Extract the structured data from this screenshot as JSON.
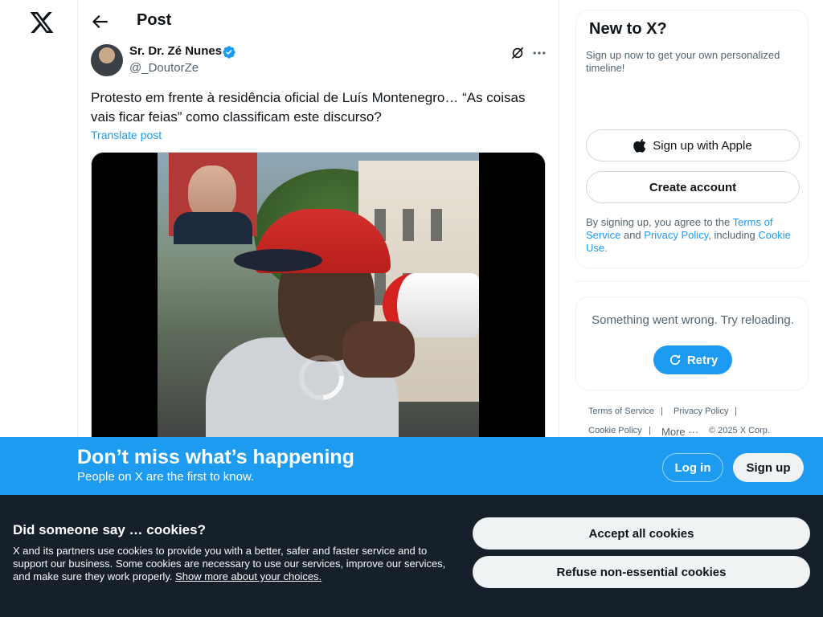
{
  "header": {
    "title": "Post"
  },
  "post": {
    "author_name": "Sr. Dr. Zé Nunes",
    "author_handle": "@_DoutorZe",
    "text": "Protesto em frente à residência oficial de Luís Montenegro… “As coisas vais ficar feias” como classificam este discurso?",
    "translate_label": "Translate post"
  },
  "signup_card": {
    "title": "New to X?",
    "subtitle": "Sign up now to get your own personalized timeline!",
    "apple_label": "Sign up with Apple",
    "create_label": "Create account",
    "terms_prefix": "By signing up, you agree to the ",
    "terms_link": "Terms of Service",
    "terms_and": " and ",
    "privacy_link": "Privacy Policy",
    "terms_including": ", including ",
    "cookie_link": "Cookie Use.",
    "terms_end": ""
  },
  "error_card": {
    "message": "Something went wrong. Try reloading.",
    "retry_label": "Retry"
  },
  "footer": {
    "terms": "Terms of Service",
    "privacy": "Privacy Policy",
    "cookie": "Cookie Policy",
    "more": "More ···",
    "copyright": "© 2025 X Corp."
  },
  "banner": {
    "title": "Don’t miss what’s happening",
    "subtitle": "People on X are the first to know.",
    "login_label": "Log in",
    "signup_label": "Sign up"
  },
  "cookie_banner": {
    "title": "Did someone say … cookies?",
    "body": "X and its partners use cookies to provide you with a better, safer and faster service and to support our business. Some cookies are necessary to use our services, improve our services, and make sure they work properly. ",
    "link": "Show more about your choices.",
    "accept_label": "Accept all cookies",
    "refuse_label": "Refuse non-essential cookies"
  },
  "colors": {
    "accent": "#1d9bf0",
    "cookie_bg": "#15202b",
    "text": "#0f1419",
    "muted": "#536471"
  }
}
